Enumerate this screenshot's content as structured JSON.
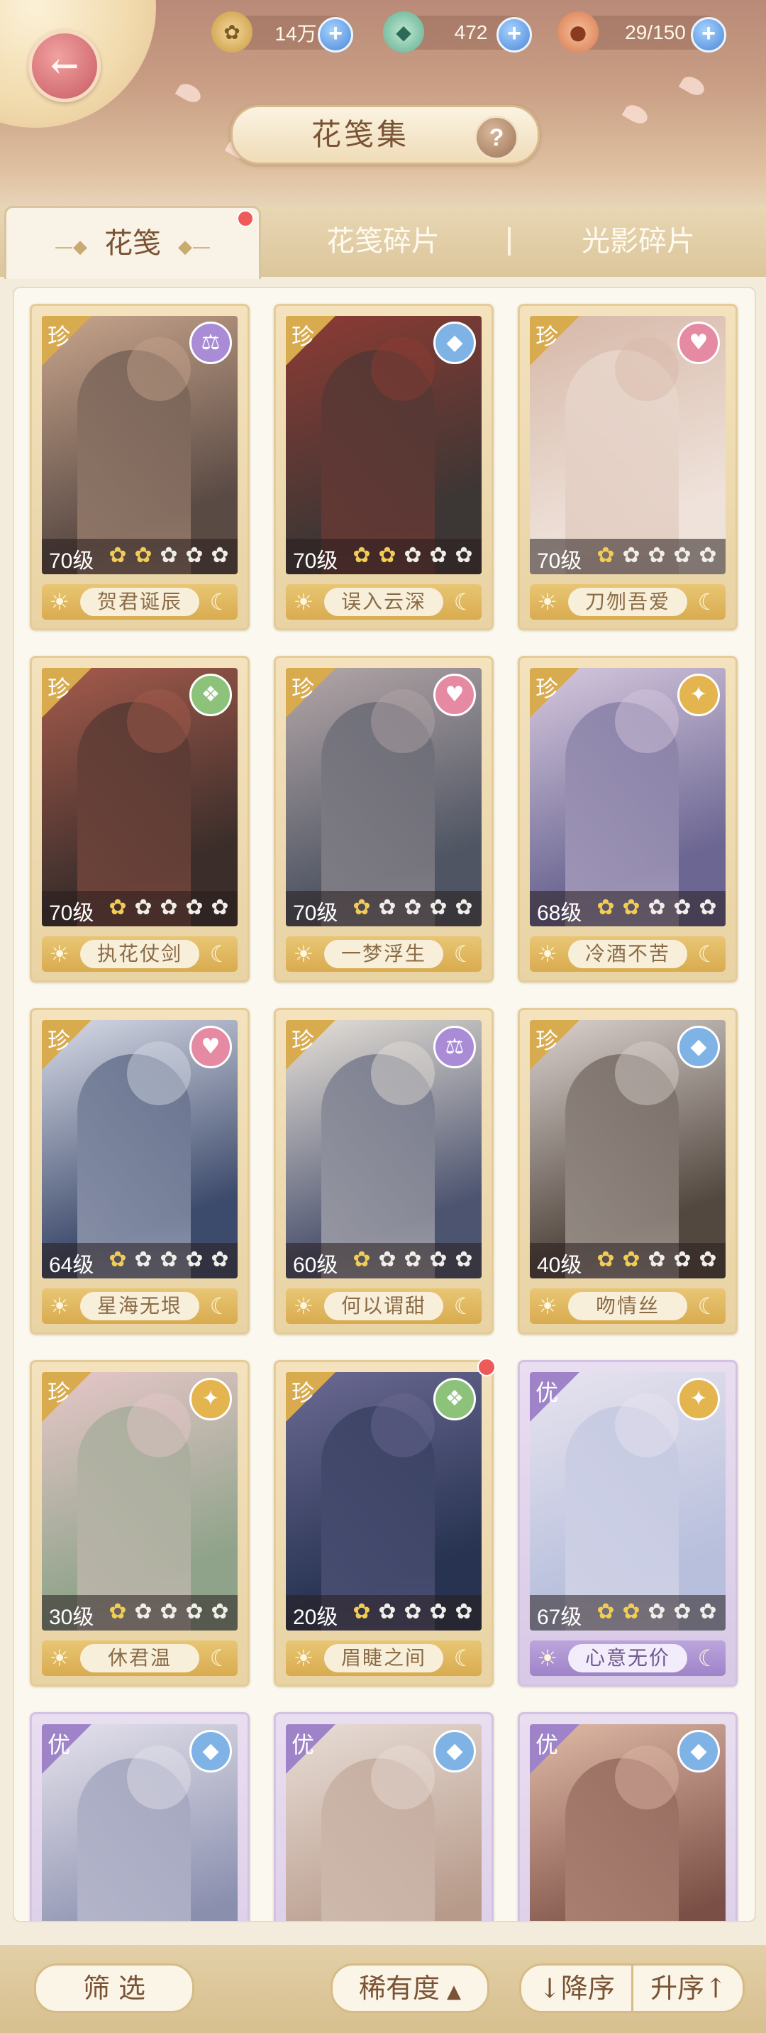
{
  "header": {
    "title": "花笺集",
    "back_icon": "back-arrow-icon",
    "help_icon": "question-icon",
    "resources": [
      {
        "name": "coin",
        "icon": "paw-coin-icon",
        "value": "14万"
      },
      {
        "name": "jade",
        "icon": "jade-fish-icon",
        "value": "472"
      },
      {
        "name": "stamina",
        "icon": "mooncake-icon",
        "value": "29/150"
      }
    ]
  },
  "tabs": [
    {
      "label": "花笺",
      "active": true,
      "badge": true
    },
    {
      "label": "花笺碎片",
      "active": false
    },
    {
      "label": "光影碎片",
      "active": false
    }
  ],
  "cards": [
    {
      "name": "贺君诞辰",
      "rarity": "珍",
      "level": "70级",
      "stars": 2,
      "attribute": "scales-icon",
      "attrColor": "#a98bd6",
      "badge": false,
      "palette": [
        "#5a4a44",
        "#c8a58c"
      ]
    },
    {
      "name": "误入云深",
      "rarity": "珍",
      "level": "70级",
      "stars": 2,
      "attribute": "water-drop-icon",
      "attrColor": "#7fb3e6",
      "badge": false,
      "palette": [
        "#3c3634",
        "#8e3b34"
      ]
    },
    {
      "name": "刀刎吾爱",
      "rarity": "珍",
      "level": "70级",
      "stars": 1,
      "attribute": "heart-icon",
      "attrColor": "#e68aa3",
      "badge": false,
      "palette": [
        "#efe2da",
        "#d6b8a8"
      ]
    },
    {
      "name": "执花仗剑",
      "rarity": "珍",
      "level": "70级",
      "stars": 1,
      "attribute": "leaf-icon",
      "attrColor": "#8cc27a",
      "badge": false,
      "palette": [
        "#3a2d2a",
        "#a55b4c"
      ]
    },
    {
      "name": "一梦浮生",
      "rarity": "珍",
      "level": "70级",
      "stars": 1,
      "attribute": "heart-icon",
      "attrColor": "#e68aa3",
      "badge": false,
      "palette": [
        "#4f5563",
        "#b4a7a8"
      ]
    },
    {
      "name": "冷酒不苦",
      "rarity": "珍",
      "level": "68级",
      "stars": 2,
      "attribute": "sun-bird-icon",
      "attrColor": "#e4b44f",
      "badge": false,
      "palette": [
        "#6b6692",
        "#d6c8de"
      ]
    },
    {
      "name": "星海无垠",
      "rarity": "珍",
      "level": "64级",
      "stars": 1,
      "attribute": "heart-icon",
      "attrColor": "#e68aa3",
      "badge": false,
      "palette": [
        "#3c4a6b",
        "#d8dbe7"
      ]
    },
    {
      "name": "何以谓甜",
      "rarity": "珍",
      "level": "60级",
      "stars": 1,
      "attribute": "scales-icon",
      "attrColor": "#a98bd6",
      "badge": false,
      "palette": [
        "#4d5470",
        "#e7e1d8"
      ]
    },
    {
      "name": "吻情丝",
      "rarity": "珍",
      "level": "40级",
      "stars": 2,
      "attribute": "water-drop-icon",
      "attrColor": "#7fb3e6",
      "badge": false,
      "palette": [
        "#53483f",
        "#dbd2cf"
      ]
    },
    {
      "name": "休君温",
      "rarity": "珍",
      "level": "30级",
      "stars": 1,
      "attribute": "sun-bird-icon",
      "attrColor": "#e4b44f",
      "badge": false,
      "palette": [
        "#8fa38a",
        "#e7c7c9"
      ]
    },
    {
      "name": "眉睫之间",
      "rarity": "珍",
      "level": "20级",
      "stars": 1,
      "attribute": "leaf-icon",
      "attrColor": "#8cc27a",
      "badge": true,
      "palette": [
        "#273351",
        "#6c6a93"
      ]
    },
    {
      "name": "心意无价",
      "rarity": "优",
      "level": "67级",
      "stars": 2,
      "attribute": "sun-bird-icon",
      "attrColor": "#e4b44f",
      "badge": false,
      "palette": [
        "#b7bfdc",
        "#e8e4ef"
      ]
    },
    {
      "name": "",
      "rarity": "优",
      "level": "",
      "stars": 0,
      "attribute": "water-drop-icon",
      "attrColor": "#7fb3e6",
      "badge": false,
      "palette": [
        "#8a8fae",
        "#e5e2ec"
      ]
    },
    {
      "name": "",
      "rarity": "优",
      "level": "",
      "stars": 0,
      "attribute": "water-drop-icon",
      "attrColor": "#7fb3e6",
      "badge": false,
      "palette": [
        "#b79a8a",
        "#e8ddd6"
      ]
    },
    {
      "name": "",
      "rarity": "优",
      "level": "",
      "stars": 0,
      "attribute": "water-drop-icon",
      "attrColor": "#7fb3e6",
      "badge": false,
      "palette": [
        "#7a4f45",
        "#e0b9a6"
      ]
    }
  ],
  "bottom": {
    "filter_label": "筛 选",
    "sort_label": "稀有度",
    "desc_label": "↓降序",
    "asc_label": "升序↑"
  },
  "colors": {
    "rarity_zhen": "#d9ab4f",
    "rarity_you": "#9e83c8",
    "accent": "#7a5334"
  }
}
